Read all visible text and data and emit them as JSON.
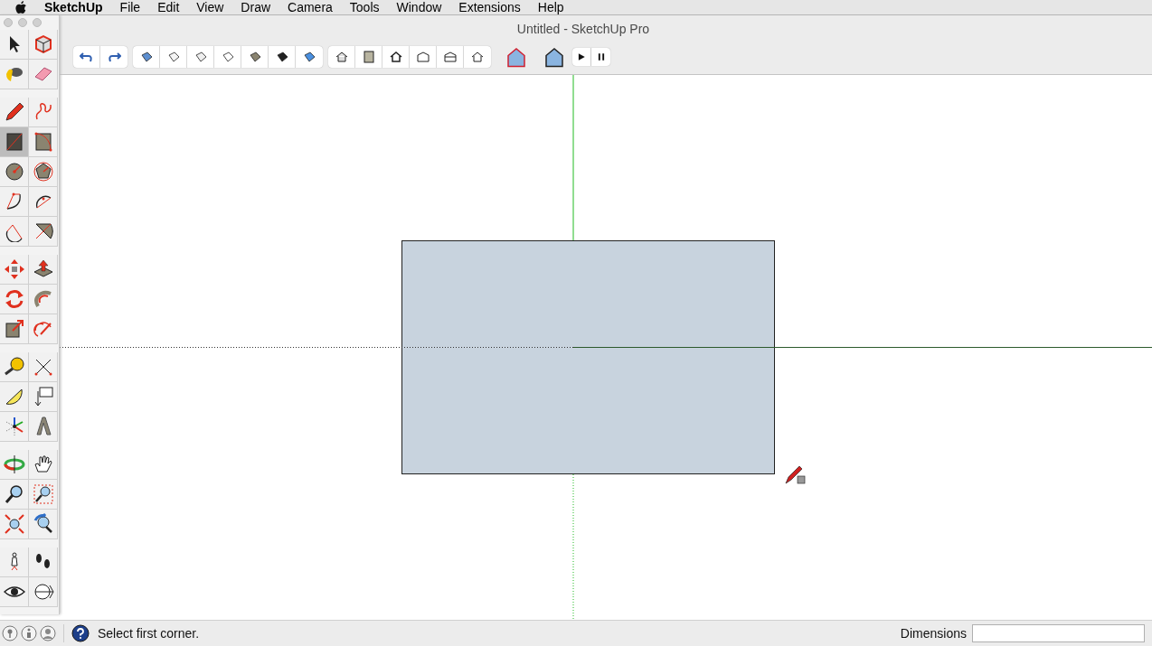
{
  "menu_bar": {
    "app_name": "SketchUp",
    "items": [
      "File",
      "Edit",
      "View",
      "Draw",
      "Camera",
      "Tools",
      "Window",
      "Extensions",
      "Help"
    ]
  },
  "window": {
    "title": "Untitled - SketchUp Pro"
  },
  "tool_palette": [
    [
      [
        {
          "kind": "select",
          "selected": false
        },
        {
          "kind": "component",
          "selected": false
        }
      ],
      [
        {
          "kind": "paint",
          "selected": false
        },
        {
          "kind": "eraser",
          "selected": false
        }
      ]
    ],
    [
      [
        {
          "kind": "pencil",
          "selected": false
        },
        {
          "kind": "freehand",
          "selected": false
        }
      ],
      [
        {
          "kind": "rectangle",
          "selected": true
        },
        {
          "kind": "rotated-rectangle",
          "selected": false
        }
      ],
      [
        {
          "kind": "circle",
          "selected": false
        },
        {
          "kind": "polygon",
          "selected": false
        }
      ],
      [
        {
          "kind": "arc",
          "selected": false
        },
        {
          "kind": "two-point-arc",
          "selected": false
        }
      ],
      [
        {
          "kind": "three-point-arc",
          "selected": false
        },
        {
          "kind": "pie",
          "selected": false
        }
      ]
    ],
    [
      [
        {
          "kind": "move",
          "selected": false
        },
        {
          "kind": "push-pull",
          "selected": false
        }
      ],
      [
        {
          "kind": "rotate",
          "selected": false
        },
        {
          "kind": "follow-me",
          "selected": false
        }
      ],
      [
        {
          "kind": "scale",
          "selected": false
        },
        {
          "kind": "offset",
          "selected": false
        }
      ]
    ],
    [
      [
        {
          "kind": "tape",
          "selected": false
        },
        {
          "kind": "dimension",
          "selected": false
        }
      ],
      [
        {
          "kind": "protractor",
          "selected": false
        },
        {
          "kind": "text",
          "selected": false
        }
      ],
      [
        {
          "kind": "axes",
          "selected": false
        },
        {
          "kind": "text-3d",
          "selected": false
        }
      ]
    ],
    [
      [
        {
          "kind": "orbit",
          "selected": false
        },
        {
          "kind": "pan",
          "selected": false
        }
      ],
      [
        {
          "kind": "zoom",
          "selected": false
        },
        {
          "kind": "zoom-window",
          "selected": false
        }
      ],
      [
        {
          "kind": "zoom-extents",
          "selected": false
        },
        {
          "kind": "previous",
          "selected": false
        }
      ]
    ],
    [
      [
        {
          "kind": "position-camera",
          "selected": false
        },
        {
          "kind": "walk",
          "selected": false
        }
      ],
      [
        {
          "kind": "look-around",
          "selected": false
        },
        {
          "kind": "section-plane",
          "selected": false
        }
      ]
    ]
  ],
  "status_bar": {
    "message": "Select first corner.",
    "dimensions_label": "Dimensions"
  }
}
